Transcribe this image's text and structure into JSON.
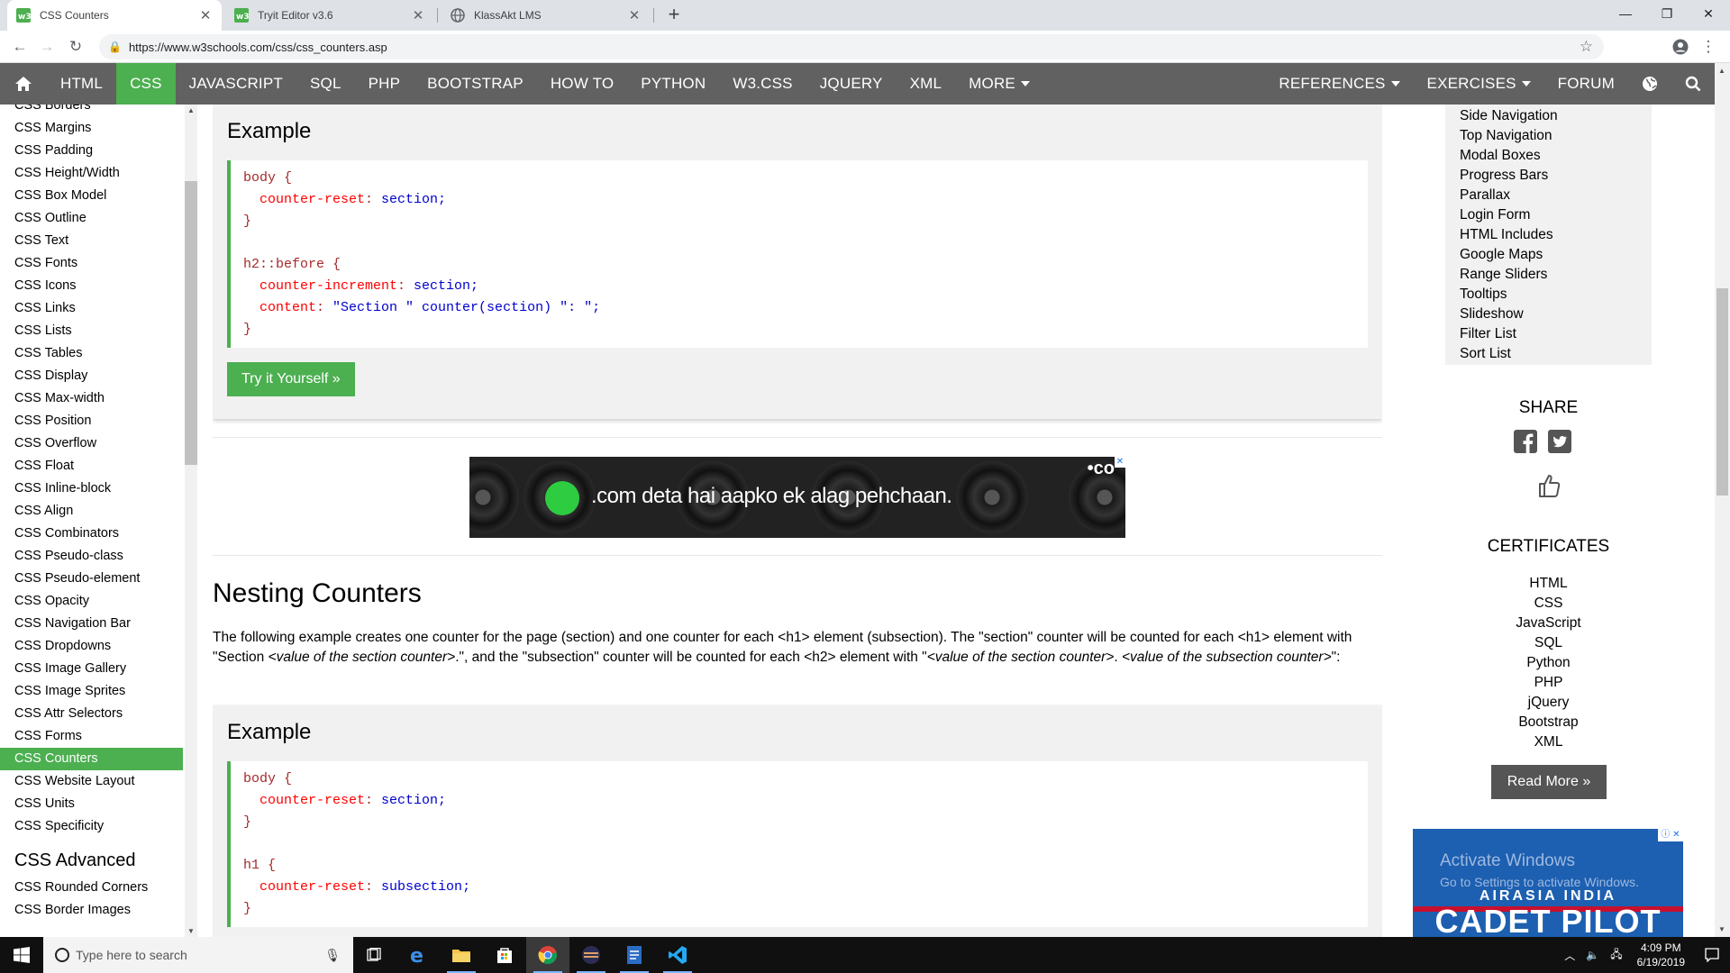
{
  "browser": {
    "tabs": [
      {
        "title": "CSS Counters",
        "active": true
      },
      {
        "title": "Tryit Editor v3.6",
        "active": false
      },
      {
        "title": "KlassAkt LMS",
        "active": false
      }
    ],
    "new_tab": "+",
    "url": "https://www.w3schools.com/css/css_counters.asp"
  },
  "topnav": {
    "home_icon": "home-icon",
    "items": [
      "HTML",
      "CSS",
      "JAVASCRIPT",
      "SQL",
      "PHP",
      "BOOTSTRAP",
      "HOW TO",
      "PYTHON",
      "W3.CSS",
      "JQUERY",
      "XML",
      "MORE"
    ],
    "active": "CSS",
    "right_items": [
      "REFERENCES",
      "EXERCISES",
      "FORUM"
    ],
    "accent_color": "#4CAF50",
    "bar_color": "#616161"
  },
  "sidebar": {
    "items": [
      "CSS Borders",
      "CSS Margins",
      "CSS Padding",
      "CSS Height/Width",
      "CSS Box Model",
      "CSS Outline",
      "CSS Text",
      "CSS Fonts",
      "CSS Icons",
      "CSS Links",
      "CSS Lists",
      "CSS Tables",
      "CSS Display",
      "CSS Max-width",
      "CSS Position",
      "CSS Overflow",
      "CSS Float",
      "CSS Inline-block",
      "CSS Align",
      "CSS Combinators",
      "CSS Pseudo-class",
      "CSS Pseudo-element",
      "CSS Opacity",
      "CSS Navigation Bar",
      "CSS Dropdowns",
      "CSS Image Gallery",
      "CSS Image Sprites",
      "CSS Attr Selectors",
      "CSS Forms",
      "CSS Counters",
      "CSS Website Layout",
      "CSS Units",
      "CSS Specificity"
    ],
    "active": "CSS Counters",
    "advanced_heading": "CSS Advanced",
    "advanced_items": [
      "CSS Rounded Corners",
      "CSS Border Images"
    ]
  },
  "main": {
    "example1": {
      "heading": "Example",
      "code": [
        {
          "sel": "body {"
        },
        {
          "prop": "  counter-reset",
          "val": " section;"
        },
        {
          "sel": "}"
        },
        {
          "sel": ""
        },
        {
          "sel": "h2::before {"
        },
        {
          "prop": "  counter-increment",
          "val": " section;"
        },
        {
          "prop": "  content",
          "val": " \"Section \" counter(section) \": \";"
        },
        {
          "sel": "}"
        }
      ],
      "button": "Try it Yourself »"
    },
    "ad": {
      "text": ".com deta hai aapko ek alag pehchaan.",
      "brand": "•co"
    },
    "section_title": "Nesting Counters",
    "paragraph": {
      "p1": "The following example creates one counter for the page (section) and one counter for each <h1> element (subsection). The \"section\" counter will be counted for each <h1> element with \"Section ",
      "i1": "<value of the section counter>",
      "p2": ".\", and the \"subsection\" counter will be counted for each <h2> element with \"",
      "i2": "<value of the section counter>",
      "p3": ". ",
      "i3": "<value of the subsection counter>",
      "p4": "\":"
    },
    "example2": {
      "heading": "Example",
      "code": [
        {
          "sel": "body {"
        },
        {
          "prop": "  counter-reset",
          "val": " section;"
        },
        {
          "sel": "}"
        },
        {
          "sel": ""
        },
        {
          "sel": "h1 {"
        },
        {
          "prop": "  counter-reset",
          "val": " subsection;"
        },
        {
          "sel": "}"
        }
      ]
    }
  },
  "right": {
    "howto_items": [
      "Side Navigation",
      "Top Navigation",
      "Modal Boxes",
      "Progress Bars",
      "Parallax",
      "Login Form",
      "HTML Includes",
      "Google Maps",
      "Range Sliders",
      "Tooltips",
      "Slideshow",
      "Filter List",
      "Sort List"
    ],
    "share_heading": "SHARE",
    "certs_heading": "CERTIFICATES",
    "certs": [
      "HTML",
      "CSS",
      "JavaScript",
      "SQL",
      "Python",
      "PHP",
      "jQuery",
      "Bootstrap",
      "XML"
    ],
    "read_more": "Read More »",
    "ad": {
      "activate_title": "Activate Windows",
      "activate_sub": "Go to Settings to activate Windows.",
      "line1": "AIRASIA INDIA",
      "line2": "CADET PILOT"
    }
  },
  "taskbar": {
    "search_placeholder": "Type here to search",
    "time": "4:09 PM",
    "date": "6/19/2019"
  }
}
